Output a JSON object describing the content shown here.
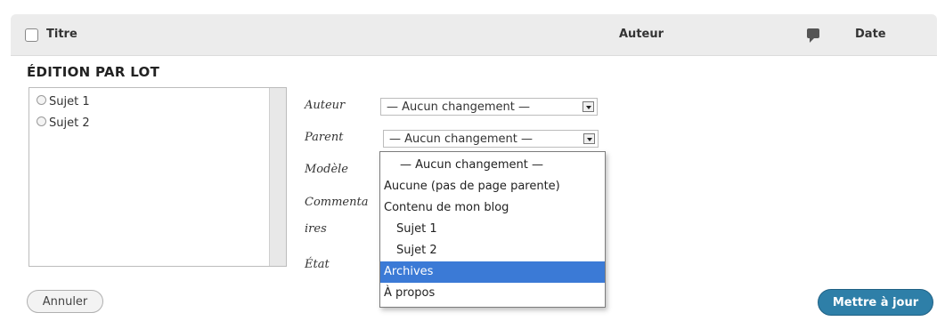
{
  "table_header": {
    "title_col": "Titre",
    "author_col": "Auteur",
    "comments_icon": "comment-bubble-icon",
    "date_col": "Date"
  },
  "bulk_edit": {
    "heading": "ÉDITION PAR LOT",
    "selected_items": [
      "Sujet 1",
      "Sujet 2"
    ],
    "fields": {
      "author_label": "Auteur",
      "author_value": "— Aucun changement —",
      "parent_label": "Parent",
      "parent_value": "— Aucun changement —",
      "template_label": "Modèle",
      "comments_label_line1": "Commenta",
      "comments_label_line2": "ires",
      "status_label": "État"
    },
    "parent_options": [
      "— Aucun changement —",
      "Aucune (pas de page parente)",
      "Contenu de mon blog",
      "Sujet 1",
      "Sujet 2",
      "Archives",
      "À propos"
    ],
    "parent_highlighted": "Archives",
    "cancel_label": "Annuler",
    "update_label": "Mettre à jour"
  },
  "colors": {
    "highlight": "#3b7ad6",
    "primary_button": "#2e7fa8"
  }
}
